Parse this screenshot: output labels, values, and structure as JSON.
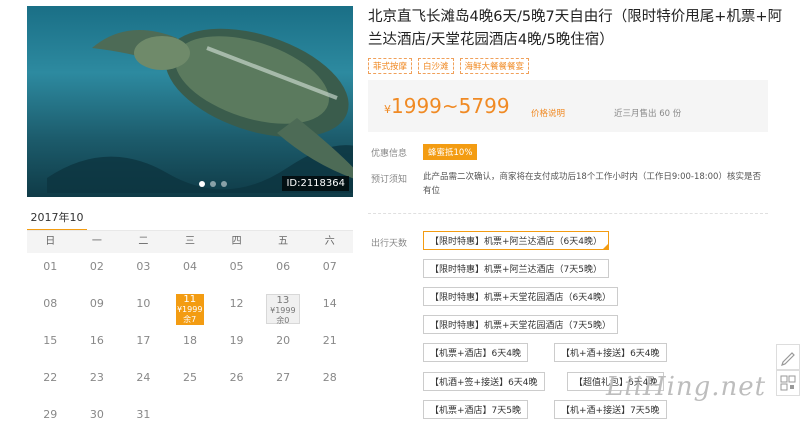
{
  "photo": {
    "id_label": "ID:2118364",
    "dots": 3,
    "active_dot": 0
  },
  "calendar": {
    "month": "2017年10月",
    "weekdays": [
      "日",
      "一",
      "二",
      "三",
      "四",
      "五",
      "六"
    ],
    "rows": [
      [
        "01",
        "02",
        "03",
        "04",
        "05",
        "06",
        "07"
      ],
      [
        "08",
        "09",
        "10",
        "11",
        "12",
        "13",
        "14"
      ],
      [
        "15",
        "16",
        "17",
        "18",
        "19",
        "20",
        "21"
      ],
      [
        "22",
        "23",
        "24",
        "25",
        "26",
        "27",
        "28"
      ],
      [
        "29",
        "30",
        "31",
        "",
        "",
        "",
        ""
      ]
    ],
    "selected": {
      "day": "11",
      "price": "¥1999",
      "stock": "余7"
    },
    "gray": {
      "day": "13",
      "price": "¥1999",
      "stock": "余0"
    }
  },
  "product": {
    "title": "北京直飞长滩岛4晚6天/5晚7天自由行（限时特价甩尾+机票+阿兰达酒店/天堂花园酒店4晚/5晚住宿）",
    "tags": [
      "菲式按摩",
      "白沙滩",
      "海鲜大餐餐餐宴"
    ],
    "price_symbol": "¥",
    "price": "1999~5799",
    "price_note": "价格说明",
    "sold": "近三月售出 60 份",
    "discount_label": "优惠信息",
    "discount_badge": "蜂蜜抵10%",
    "notice_label": "预订须知",
    "notice_text": "此产品需二次确认，商家将在支付成功后18个工作小时内（工作日9:00-18:00）核实是否有位",
    "days_label": "出行天数"
  },
  "options": [
    "【限时特惠】机票+阿兰达酒店（6天4晚）",
    "【限时特惠】机票+阿兰达酒店（7天5晚）",
    "【限时特惠】机票+天堂花园酒店（6天4晚）",
    "【限时特惠】机票+天堂花园酒店（7天5晚）",
    "【机票+酒店】6天4晚",
    "【机+酒+接送】6天4晚",
    "【机酒+签+接送】6天4晚",
    "【超值礼包】6天4晚",
    "【机票+酒店】7天5晚",
    "【机+酒+接送】7天5晚"
  ],
  "watermark": "LiiHing.net"
}
